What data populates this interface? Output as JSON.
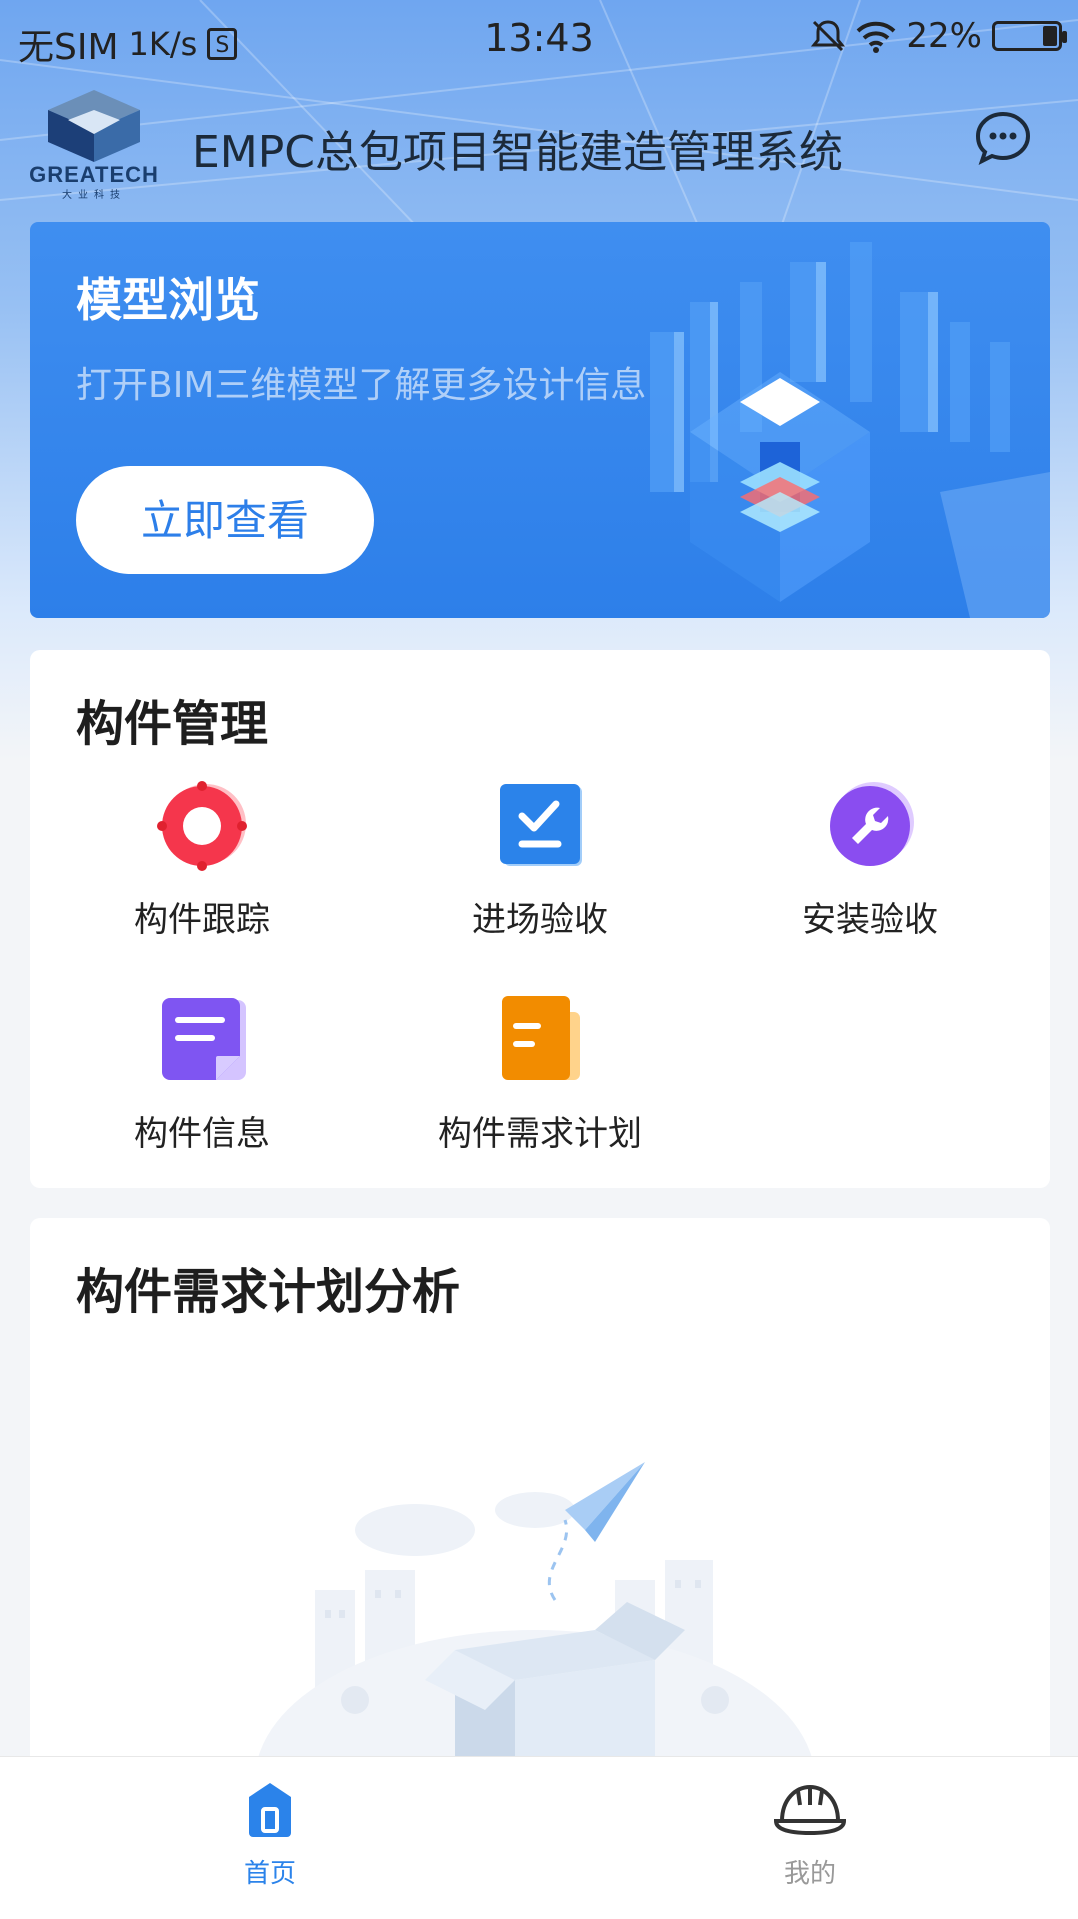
{
  "status_bar": {
    "carrier": "无SIM",
    "speed": "1K/s",
    "sim_icon": "S",
    "time": "13:43",
    "battery": "22%"
  },
  "header": {
    "logo_text": "GREATECH",
    "logo_sub": "大业科技",
    "title": "EMPC总包项目智能建造管理系统",
    "chat_icon": "chat-bubble-icon"
  },
  "banner": {
    "title": "模型浏览",
    "subtitle": "打开BIM三维模型了解更多设计信息",
    "button": "立即查看"
  },
  "component_mgmt": {
    "title": "构件管理",
    "items": [
      {
        "label": "构件跟踪",
        "icon": "target-icon",
        "color": "#f5364c"
      },
      {
        "label": "进场验收",
        "icon": "checklist-icon",
        "color": "#2b83ea"
      },
      {
        "label": "安装验收",
        "icon": "wrench-icon",
        "color": "#8a4df0"
      },
      {
        "label": "构件信息",
        "icon": "document-icon",
        "color": "#7f55f2"
      },
      {
        "label": "构件需求计划",
        "icon": "plan-file-icon",
        "color": "#f28c00"
      }
    ]
  },
  "analysis": {
    "title": "构件需求计划分析"
  },
  "tabbar": {
    "tabs": [
      {
        "label": "首页",
        "icon": "home-icon",
        "active": true,
        "color": "#2b83ea"
      },
      {
        "label": "我的",
        "icon": "helmet-icon",
        "active": false,
        "color": "#999999"
      }
    ]
  }
}
